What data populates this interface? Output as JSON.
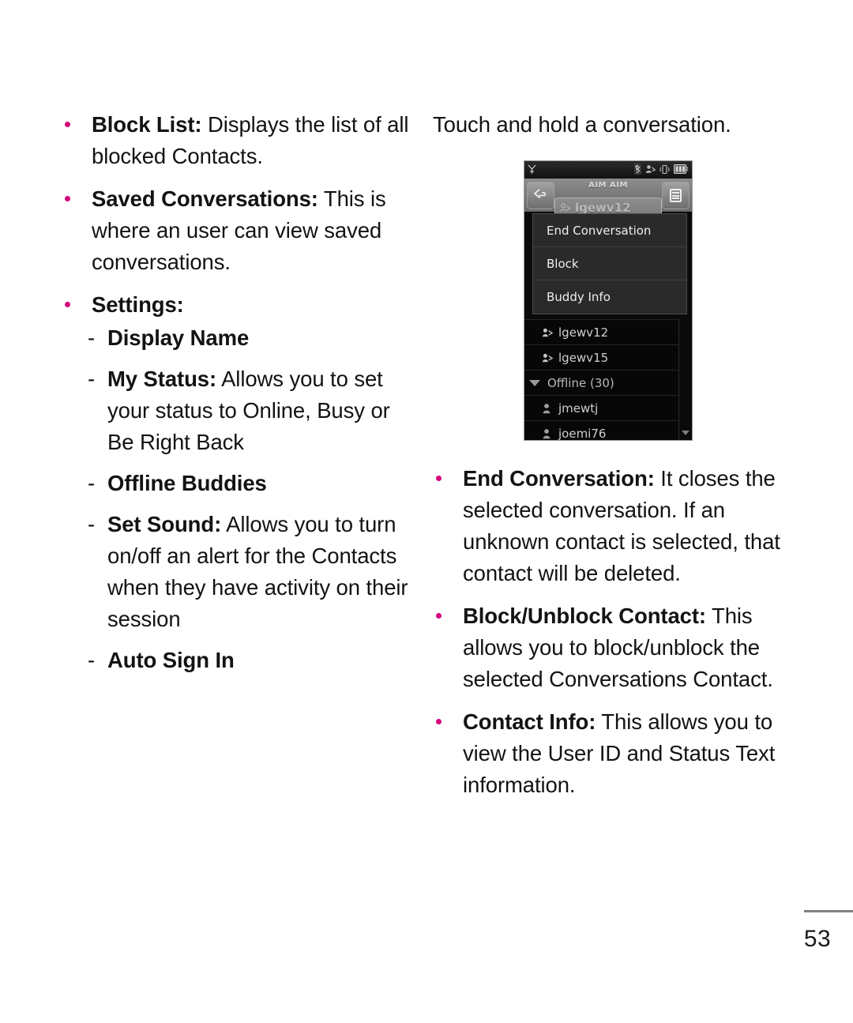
{
  "document": {
    "page_number": "53"
  },
  "left_column": {
    "bullets": [
      {
        "bold": "Block List:",
        "rest": " Displays the list of all blocked Contacts."
      },
      {
        "bold": "Saved Conversations:",
        "rest": " This is where an user can view saved conversations."
      },
      {
        "bold": "Settings:",
        "rest": ""
      }
    ],
    "sub_items": [
      {
        "dash": "-",
        "bold": "Display Name",
        "rest": ""
      },
      {
        "dash": "-",
        "bold": "My Status:",
        "rest": " Allows you to set your status to Online, Busy or Be Right Back"
      },
      {
        "dash": "-",
        "bold": "Offline Buddies",
        "rest": ""
      },
      {
        "dash": "-",
        "bold": "Set Sound:",
        "rest": " Allows you to turn on/off an alert for the Contacts when they have activity on their session"
      },
      {
        "dash": "-",
        "bold": "Auto Sign In",
        "rest": ""
      }
    ]
  },
  "right_column": {
    "intro": "Touch and hold a conversation.",
    "bullets": [
      {
        "bold": "End Conversation:",
        "rest": " It closes the selected conversation. If an unknown contact is selected, that contact will be deleted."
      },
      {
        "bold": "Block/Unblock Contact:",
        "rest": " This allows you to block/unblock the selected Conversations Contact."
      },
      {
        "bold": "Contact Info:",
        "rest": " This allows you to view the User ID and Status Text information."
      }
    ]
  },
  "phone_screenshot": {
    "status_bar": {
      "signal_icon": "signal-antenna-icon",
      "bluetooth_icon": "bluetooth-icon",
      "buddy_icon": "buddy-status-icon",
      "vibrate_icon": "vibrate-icon",
      "battery_icon": "battery-icon"
    },
    "title": "AIM AIM",
    "back_button_label": "back-arrow",
    "menu_button_label": "menu",
    "selected_conversation": "lgewv12",
    "context_menu": [
      "End Conversation",
      "Block",
      "Buddy Info"
    ],
    "buddy_list": [
      {
        "name": "lgewv12",
        "type": "online"
      },
      {
        "name": "lgewv15",
        "type": "online"
      },
      {
        "name": "Offline (30)",
        "type": "group"
      },
      {
        "name": "jmewtj",
        "type": "offline"
      },
      {
        "name": "joemi76",
        "type": "offline"
      }
    ]
  },
  "colors": {
    "bullet": "#d4007a",
    "text": "#131313"
  }
}
